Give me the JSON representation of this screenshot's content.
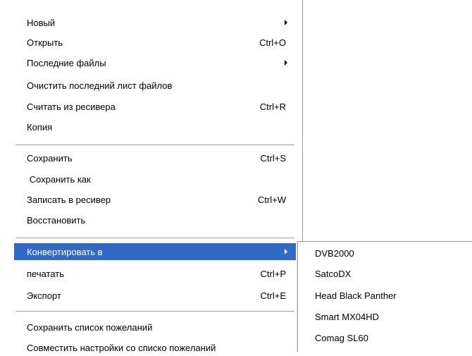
{
  "menu": {
    "items": [
      {
        "label": "Новый",
        "shortcut": "",
        "submenu": true
      },
      {
        "label": "Открыть",
        "shortcut": "Ctrl+O",
        "submenu": false
      },
      {
        "label": "Последние файлы",
        "shortcut": "",
        "submenu": true
      },
      {
        "label": "Очистить последний лист файлов",
        "shortcut": "",
        "submenu": false
      },
      {
        "label": "Считать из ресивера",
        "shortcut": "Ctrl+R",
        "submenu": false
      },
      {
        "label": "Копия",
        "shortcut": "",
        "submenu": false
      },
      {
        "label": "Сохранить",
        "shortcut": "Ctrl+S",
        "submenu": false
      },
      {
        "label": " Сохранить как",
        "shortcut": "",
        "submenu": false
      },
      {
        "label": "Записать в ресивер",
        "shortcut": "Ctrl+W",
        "submenu": false
      },
      {
        "label": "Восстановить",
        "shortcut": "",
        "submenu": false
      },
      {
        "label": "Конвертировать в",
        "shortcut": "",
        "submenu": true
      },
      {
        "label": "печатать",
        "shortcut": "Ctrl+P",
        "submenu": false
      },
      {
        "label": "Экспорт",
        "shortcut": "Ctrl+E",
        "submenu": false
      },
      {
        "label": "Сохранить список пожеланий",
        "shortcut": "",
        "submenu": false
      },
      {
        "label": "Совместить настройки со списко пожеланий",
        "shortcut": "",
        "submenu": false
      }
    ],
    "selected_label": "Конвертировать в"
  },
  "submenu": {
    "items": [
      "DVB2000",
      "SatcoDX",
      "Head Black Panther",
      "Smart MX04HD",
      "Comag SL60"
    ]
  },
  "colors": {
    "highlight": "#316ac5",
    "separator": "#a0a0a0"
  }
}
